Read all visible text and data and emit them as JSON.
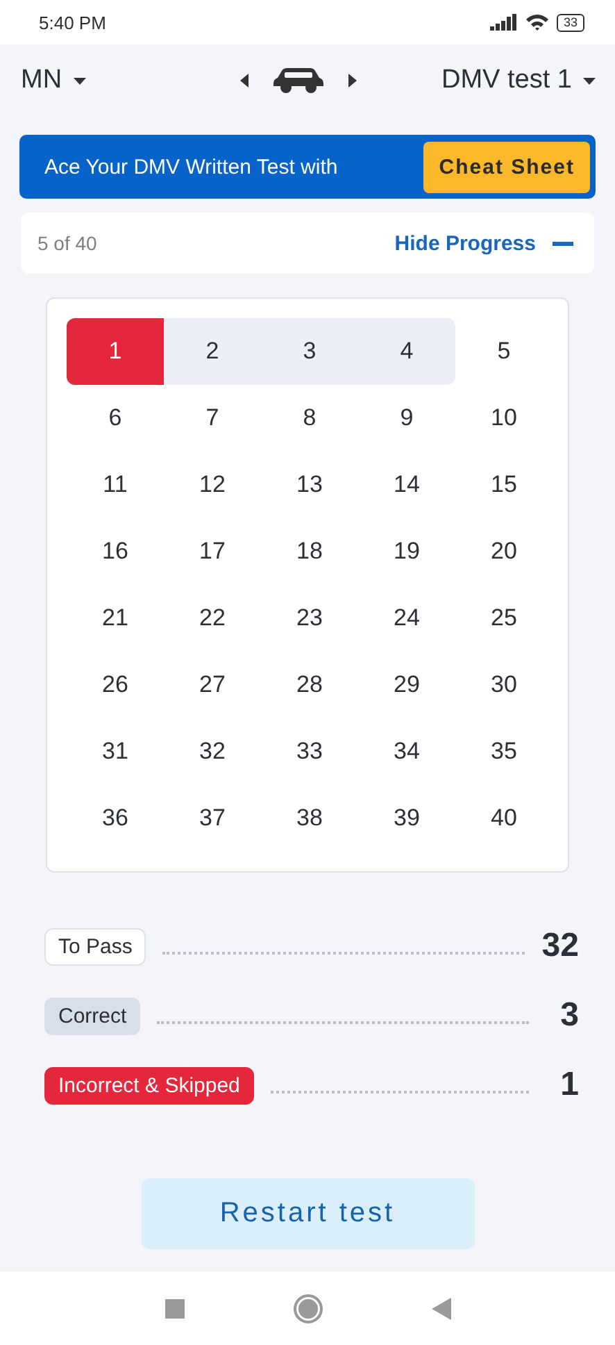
{
  "status_bar": {
    "time": "5:40 PM",
    "battery": "33"
  },
  "header": {
    "state": "MN",
    "test": "DMV test 1"
  },
  "banner": {
    "text": "Ace Your DMV Written Test with",
    "button": "Cheat Sheet"
  },
  "progress": {
    "count": "5 of 40",
    "toggle": "Hide Progress"
  },
  "questions": [
    {
      "label": "1",
      "color": "#e5273b"
    },
    {
      "label": "2",
      "color": "#ebeff8"
    },
    {
      "label": "3",
      "color": "#ebeff8"
    },
    {
      "label": "4",
      "color": "#ebeff8"
    },
    {
      "label": "5",
      "color": "#ffffff"
    },
    {
      "label": "6",
      "color": "#ffffff"
    },
    {
      "label": "7",
      "color": "#ffffff"
    },
    {
      "label": "8",
      "color": "#ffffff"
    },
    {
      "label": "9",
      "color": "#ffffff"
    },
    {
      "label": "10",
      "color": "#ffffff"
    },
    {
      "label": "11",
      "color": "#ffffff"
    },
    {
      "label": "12",
      "color": "#ffffff"
    },
    {
      "label": "13",
      "color": "#ffffff"
    },
    {
      "label": "14",
      "color": "#ffffff"
    },
    {
      "label": "15",
      "color": "#ffffff"
    },
    {
      "label": "16",
      "color": "#ffffff"
    },
    {
      "label": "17",
      "color": "#ffffff"
    },
    {
      "label": "18",
      "color": "#ffffff"
    },
    {
      "label": "19",
      "color": "#ffffff"
    },
    {
      "label": "20",
      "color": "#ffffff"
    },
    {
      "label": "21",
      "color": "#ffffff"
    },
    {
      "label": "22",
      "color": "#ffffff"
    },
    {
      "label": "23",
      "color": "#ffffff"
    },
    {
      "label": "24",
      "color": "#ffffff"
    },
    {
      "label": "25",
      "color": "#ffffff"
    },
    {
      "label": "26",
      "color": "#ffffff"
    },
    {
      "label": "27",
      "color": "#ffffff"
    },
    {
      "label": "28",
      "color": "#ffffff"
    },
    {
      "label": "29",
      "color": "#ffffff"
    },
    {
      "label": "30",
      "color": "#ffffff"
    },
    {
      "label": "31",
      "color": "#ffffff"
    },
    {
      "label": "32",
      "color": "#ffffff"
    },
    {
      "label": "33",
      "color": "#ffffff"
    },
    {
      "label": "34",
      "color": "#ffffff"
    },
    {
      "label": "35",
      "color": "#ffffff"
    },
    {
      "label": "36",
      "color": "#ffffff"
    },
    {
      "label": "37",
      "color": "#ffffff"
    },
    {
      "label": "38",
      "color": "#ffffff"
    },
    {
      "label": "39",
      "color": "#ffffff"
    },
    {
      "label": "40",
      "color": "#ffffff"
    }
  ],
  "stats": [
    {
      "kind": "outline",
      "label": "To Pass",
      "value": "32"
    },
    {
      "kind": "neutral",
      "label": "Correct",
      "value": "3"
    },
    {
      "kind": "danger",
      "label": "Incorrect & Skipped",
      "value": "1"
    }
  ],
  "restart_button": "Restart test"
}
